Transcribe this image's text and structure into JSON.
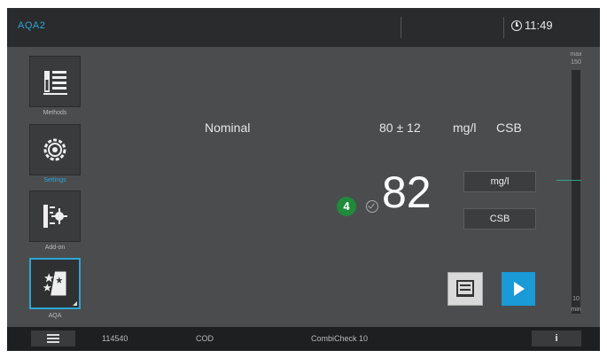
{
  "topbar": {
    "app_title": "AQA2",
    "time": "11:49"
  },
  "sidebar": {
    "items": [
      {
        "label": "Methods",
        "icon": "methods-list-icon"
      },
      {
        "label": "Settings",
        "icon": "settings-gear-icon"
      },
      {
        "label": "Add-on",
        "icon": "addon-icon"
      },
      {
        "label": "AQA",
        "icon": "aqa-stars-icon"
      }
    ]
  },
  "main": {
    "nominal_label": "Nominal",
    "nominal_value": "80 ± 12",
    "nominal_unit": "mg/l",
    "nominal_parameter": "CSB",
    "badge_number": "4",
    "measured_value": "82",
    "unit_button": "mg/l",
    "parameter_button": "CSB"
  },
  "scale": {
    "max_label": "max",
    "max_value": "150",
    "min_value": "10",
    "min_label": "min"
  },
  "bottombar": {
    "code": "114540",
    "method": "COD",
    "check": "CombiCheck 10",
    "info_label": "i"
  },
  "colors": {
    "accent": "#2aa7d6",
    "badge": "#1f8a3a",
    "play": "#1a9ad6",
    "scale_mark": "#2fa88a"
  }
}
